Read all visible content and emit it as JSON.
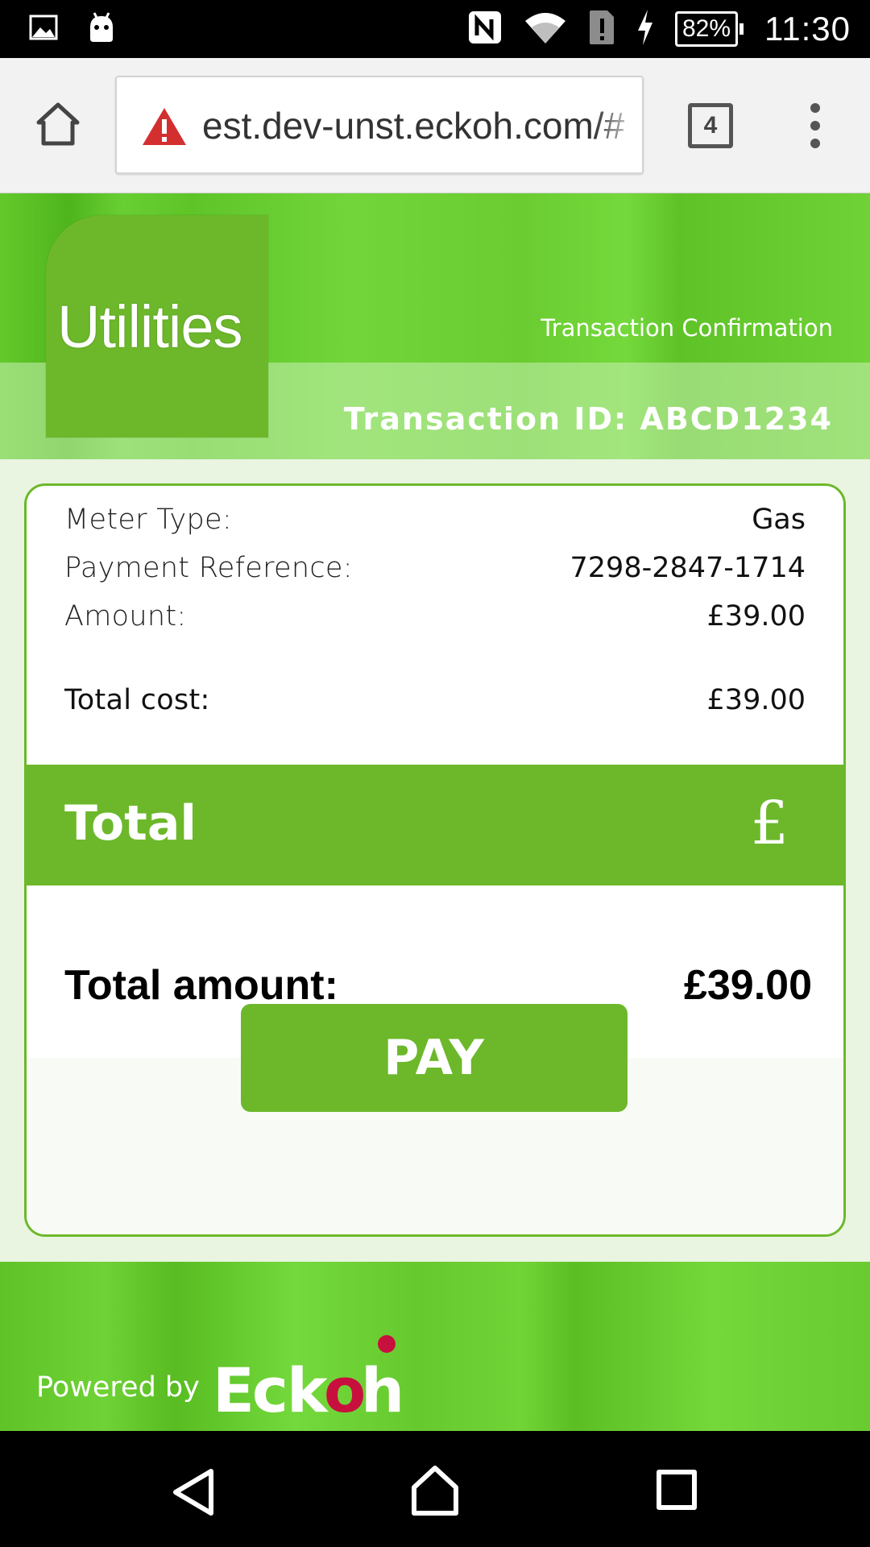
{
  "status_bar": {
    "battery_percent": "82%",
    "time": "11:30",
    "icons": [
      "gallery-icon",
      "android-icon",
      "nfc-icon",
      "wifi-icon",
      "sim-alert-icon",
      "charging-icon"
    ]
  },
  "browser": {
    "url": "est.dev-unst.eckoh.com/#",
    "tab_count": "4",
    "icons": [
      "home-icon",
      "warning-icon",
      "tab-switcher-icon",
      "overflow-menu-icon"
    ]
  },
  "header": {
    "logo_text": "Utilities",
    "subtitle": "Transaction Confirmation",
    "transaction_id": "Transaction ID: ABCD1234"
  },
  "details": {
    "meter_type_label": "Meter Type:",
    "meter_type_value": "Gas",
    "payment_ref_label": "Payment Reference:",
    "payment_ref_value": "7298-2847-1714",
    "amount_label": "Amount:",
    "amount_value": "£39.00",
    "total_cost_label": "Total cost:",
    "total_cost_value": "£39.00"
  },
  "total_band": {
    "label": "Total",
    "symbol": "£"
  },
  "total_amount": {
    "label": "Total amount:",
    "value": "£39.00"
  },
  "pay_button": {
    "label": "PAY"
  },
  "footer": {
    "powered_by": "Powered by",
    "brand": "Eckoh"
  },
  "colors": {
    "brand_green": "#6cb82a",
    "eckoh_dot": "#c8103e"
  }
}
